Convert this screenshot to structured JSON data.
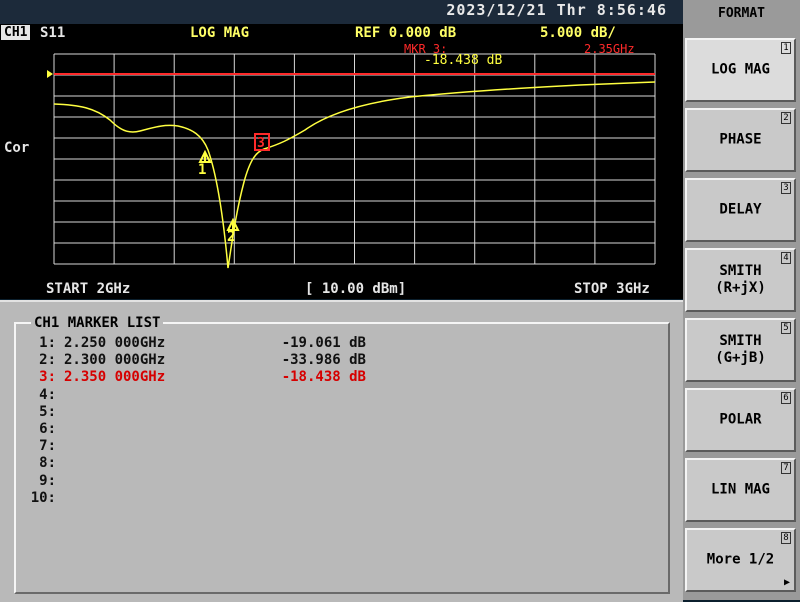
{
  "status": {
    "datetime": "2023/12/21  Thr   8:56:46"
  },
  "header": {
    "channel": "CH1",
    "param": "S11",
    "format": "LOG MAG",
    "ref": "REF   0.000 dB",
    "scale": "5.000 dB/"
  },
  "graph": {
    "marker_active_label": "MKR  3:",
    "marker_active_freq": "2.35GHz",
    "marker_active_value": "-18.438 dB",
    "correction": "Cor",
    "marker_labels": [
      "1",
      "2",
      "3"
    ]
  },
  "footer": {
    "start": "START 2GHz",
    "power": "[ 10.00 dBm]",
    "stop": "STOP 3GHz"
  },
  "marker_list": {
    "title": "CH1 MARKER LIST",
    "rows": [
      {
        "num": "1:",
        "freq": "2.250 000GHz",
        "value": "-19.061 dB"
      },
      {
        "num": "2:",
        "freq": "2.300 000GHz",
        "value": "-33.986 dB"
      },
      {
        "num": "3:",
        "freq": "2.350 000GHz",
        "value": "-18.438 dB"
      },
      {
        "num": "4:",
        "freq": "",
        "value": ""
      },
      {
        "num": "5:",
        "freq": "",
        "value": ""
      },
      {
        "num": "6:",
        "freq": "",
        "value": ""
      },
      {
        "num": "7:",
        "freq": "",
        "value": ""
      },
      {
        "num": "8:",
        "freq": "",
        "value": ""
      },
      {
        "num": "9:",
        "freq": "",
        "value": ""
      },
      {
        "num": "10:",
        "freq": "",
        "value": ""
      }
    ]
  },
  "softkeys": {
    "title": "FORMAT",
    "keys": [
      {
        "label": "LOG MAG",
        "index": "1"
      },
      {
        "label": "PHASE",
        "index": "2"
      },
      {
        "label": "DELAY",
        "index": "3"
      },
      {
        "label": "SMITH\n(R+jX)",
        "index": "4"
      },
      {
        "label": "SMITH\n(G+jB)",
        "index": "5"
      },
      {
        "label": "POLAR",
        "index": "6"
      },
      {
        "label": "LIN MAG",
        "index": "7"
      },
      {
        "label": "More 1/2",
        "index": "8"
      }
    ]
  },
  "colors": {
    "trace": "#ffff40",
    "ref_line": "#ff2a2a",
    "grid": "#e8e8e8",
    "active_marker": "#ff2a2a"
  }
}
